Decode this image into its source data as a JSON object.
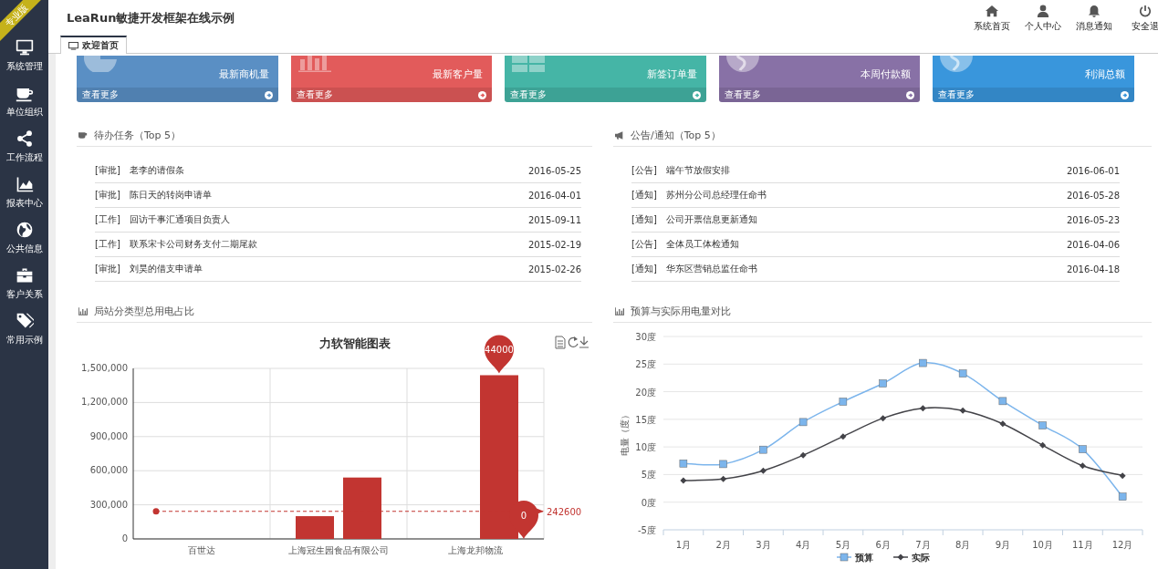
{
  "edition_ribbon": "专业版",
  "sidebar": {
    "items": [
      {
        "label": "系统管理"
      },
      {
        "label": "单位组织"
      },
      {
        "label": "工作流程"
      },
      {
        "label": "报表中心"
      },
      {
        "label": "公共信息"
      },
      {
        "label": "客户关系"
      },
      {
        "label": "常用示例"
      }
    ]
  },
  "header": {
    "title": "LeaRun敏捷开发框架在线示例",
    "actions": [
      {
        "label": "系统首页"
      },
      {
        "label": "个人中心"
      },
      {
        "label": "消息通知"
      },
      {
        "label": "安全退"
      }
    ]
  },
  "tabs": [
    {
      "label": "欢迎首页",
      "selected": true
    }
  ],
  "stat_cards": [
    {
      "label": "最新商机量",
      "link": "查看更多",
      "color": "#5a8fc4"
    },
    {
      "label": "最新客户量",
      "link": "查看更多",
      "color": "#e25b5b"
    },
    {
      "label": "新签订单量",
      "link": "查看更多",
      "color": "#45b5a6"
    },
    {
      "label": "本周付款额",
      "link": "查看更多",
      "color": "#8871a6"
    },
    {
      "label": "利润总额",
      "link": "查看更多",
      "color": "#3996dc"
    }
  ],
  "todo_panel": {
    "title": "待办任务（Top 5）",
    "items": [
      {
        "tag": "[审批]",
        "text": "老李的请假条",
        "date": "2016-05-25"
      },
      {
        "tag": "[审批]",
        "text": "陈日天的转岗申请单",
        "date": "2016-04-01"
      },
      {
        "tag": "[工作]",
        "text": "回访千事汇通项目负责人",
        "date": "2015-09-11"
      },
      {
        "tag": "[工作]",
        "text": "联系宋卡公司财务支付二期尾款",
        "date": "2015-02-19"
      },
      {
        "tag": "[审批]",
        "text": "刘昊的借支申请单",
        "date": "2015-02-26"
      }
    ]
  },
  "notice_panel": {
    "title": "公告/通知（Top 5）",
    "items": [
      {
        "tag": "[公告]",
        "text": "端午节放假安排",
        "date": "2016-06-01"
      },
      {
        "tag": "[通知]",
        "text": "苏州分公司总经理任命书",
        "date": "2016-05-28"
      },
      {
        "tag": "[通知]",
        "text": "公司开票信息更新通知",
        "date": "2016-05-23"
      },
      {
        "tag": "[公告]",
        "text": "全体员工体检通知",
        "date": "2016-04-06"
      },
      {
        "tag": "[通知]",
        "text": "华东区营销总监任命书",
        "date": "2016-04-18"
      }
    ]
  },
  "bar_panel": {
    "title": "局站分类型总用电占比",
    "chart_data": {
      "type": "bar",
      "title": "力软智能图表",
      "categories": [
        "百世达",
        "上海冠生园食品有限公司",
        "上海龙邦物流"
      ],
      "series": [
        {
          "color": "#c23531",
          "values": [
            0,
            200000,
            0
          ]
        },
        {
          "color": "#c23531",
          "values": [
            0,
            540000,
            1440000
          ]
        }
      ],
      "ylim": [
        0,
        1500000
      ],
      "yticks": [
        {
          "value": 0,
          "label": "0"
        },
        {
          "value": 300000,
          "label": "300,000"
        },
        {
          "value": 600000,
          "label": "600,000"
        },
        {
          "value": 900000,
          "label": "900,000"
        },
        {
          "value": 1200000,
          "label": "1,200,000"
        },
        {
          "value": 1500000,
          "label": "1,500,000"
        }
      ],
      "grid": true,
      "ref_lines": [
        {
          "axis": "y",
          "value": 242600,
          "label": "242600"
        }
      ],
      "annotations": [
        {
          "text": "44000",
          "x": "上海龙邦物流",
          "y": 1440000
        },
        "0"
      ]
    }
  },
  "line_panel": {
    "title": "预算与实际用电量对比",
    "chart_data": {
      "type": "line",
      "ylabel": "电量（度）",
      "categories": [
        "1月",
        "2月",
        "3月",
        "4月",
        "5月",
        "6月",
        "7月",
        "8月",
        "9月",
        "10月",
        "11月",
        "12月"
      ],
      "series": [
        {
          "name": "预算",
          "color": "#7cb5ec",
          "marker": "square",
          "values": [
            7.0,
            6.9,
            9.5,
            14.5,
            18.2,
            21.5,
            25.2,
            23.3,
            18.3,
            13.9,
            9.6,
            1.0
          ]
        },
        {
          "name": "实际",
          "color": "#434348",
          "marker": "diamond",
          "values": [
            3.9,
            4.2,
            5.7,
            8.5,
            11.9,
            15.2,
            17.0,
            16.6,
            14.2,
            10.3,
            6.6,
            4.8
          ]
        }
      ],
      "ylim": [
        -5,
        30
      ],
      "grid": true,
      "legend": true,
      "yticks": [
        {
          "value": -5,
          "label": "-5度"
        },
        {
          "value": 0,
          "label": "0度"
        },
        {
          "value": 5,
          "label": "5度"
        },
        {
          "value": 10,
          "label": "10度"
        },
        {
          "value": 15,
          "label": "15度"
        },
        {
          "value": 20,
          "label": "20度"
        },
        {
          "value": 25,
          "label": "25度"
        },
        {
          "value": 30,
          "label": "30度"
        }
      ]
    }
  }
}
